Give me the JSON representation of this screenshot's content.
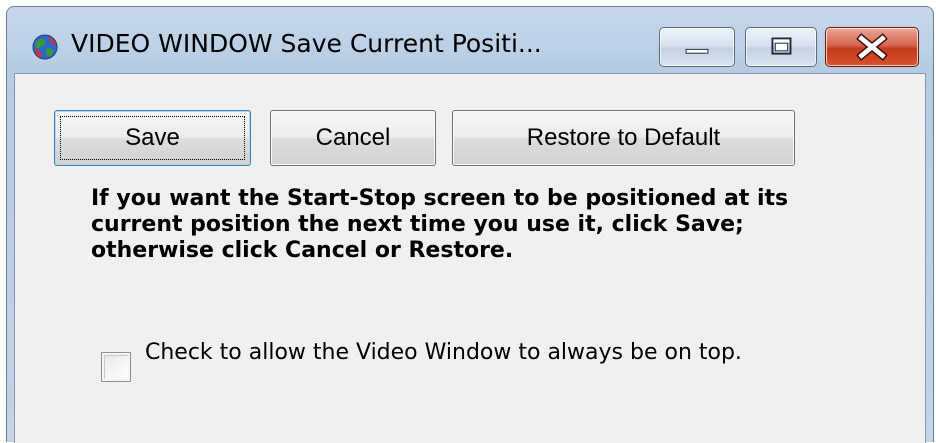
{
  "window": {
    "title": "VIDEO WINDOW Save Current Positi...",
    "icon": "globe-app-icon"
  },
  "title_controls": {
    "minimize": "minimize-icon",
    "maximize": "maximize-icon",
    "close": "close-icon"
  },
  "buttons": {
    "save_label": "Save",
    "cancel_label": "Cancel",
    "restore_label": "Restore to Default"
  },
  "message": "If you want the Start-Stop  screen to be positioned at its current position the next time you use it, click Save; otherwise click Cancel or Restore.",
  "checkbox": {
    "label": "Check to allow the Video Window to always be on top.",
    "checked": false
  },
  "colors": {
    "client_bg": "#f0f0f0",
    "close_red": "#c4391f",
    "title_glass": "#bcd0e6",
    "focus_blue": "#3c7fb1"
  }
}
